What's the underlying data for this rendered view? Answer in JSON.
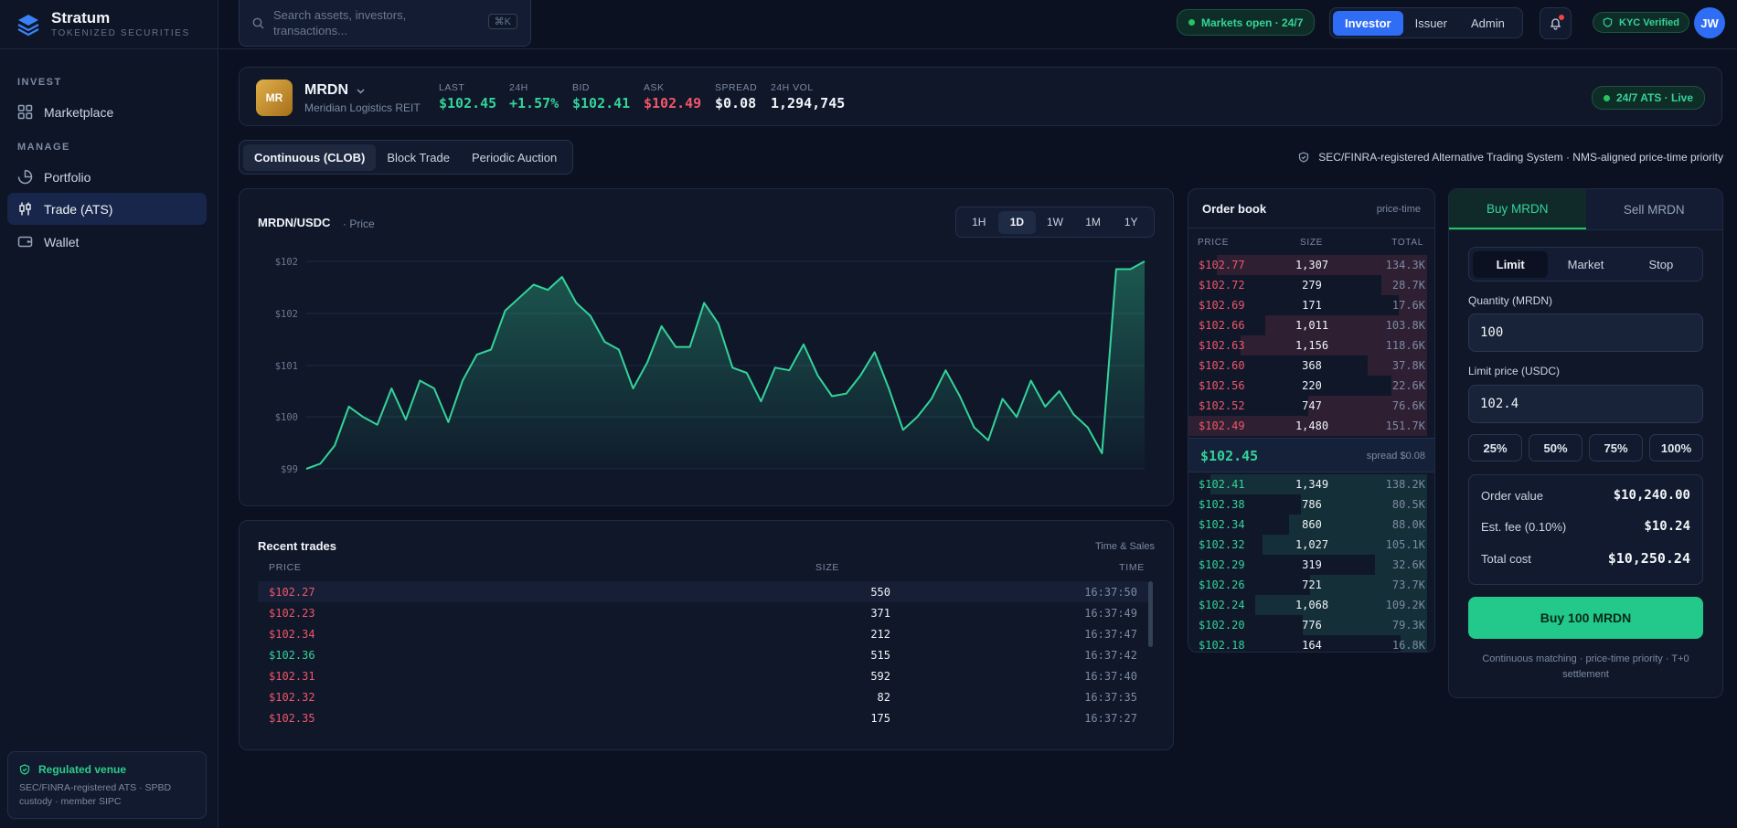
{
  "brand": {
    "name": "Stratum",
    "subtitle": "TOKENIZED SECURITIES"
  },
  "sidebar": {
    "sections": [
      {
        "label": "INVEST",
        "items": [
          {
            "label": "Marketplace",
            "icon": "grid-icon"
          }
        ]
      },
      {
        "label": "MANAGE",
        "items": [
          {
            "label": "Portfolio",
            "icon": "pie-chart-icon"
          },
          {
            "label": "Trade (ATS)",
            "icon": "candlestick-icon",
            "active": true
          },
          {
            "label": "Wallet",
            "icon": "wallet-icon"
          }
        ]
      }
    ],
    "regulated": {
      "title": "Regulated venue",
      "text": "SEC/FINRA-registered ATS · SPBD custody · member SIPC"
    }
  },
  "topbar": {
    "search_placeholder": "Search assets, investors, transactions...",
    "search_shortcut": "⌘K",
    "market_status": "Markets open · 24/7",
    "roles": [
      "Investor",
      "Issuer",
      "Admin"
    ],
    "active_role": "Investor",
    "kyc": "KYC Verified",
    "avatar_initials": "JW"
  },
  "ticker": {
    "icon_initials": "MR",
    "symbol": "MRDN",
    "name": "Meridian Logistics REIT",
    "stats": [
      {
        "label": "LAST",
        "value": "$102.45",
        "tone": "green"
      },
      {
        "label": "24H",
        "value": "+1.57%",
        "tone": "green"
      },
      {
        "label": "BID",
        "value": "$102.41",
        "tone": "green"
      },
      {
        "label": "ASK",
        "value": "$102.49",
        "tone": "red"
      },
      {
        "label": "SPREAD",
        "value": "$0.08",
        "tone": "white"
      },
      {
        "label": "24H VOL",
        "value": "1,294,745",
        "tone": "white"
      }
    ],
    "live_badge": "24/7 ATS · Live"
  },
  "modes": {
    "tabs": [
      "Continuous (CLOB)",
      "Block Trade",
      "Periodic Auction"
    ],
    "active": "Continuous (CLOB)"
  },
  "ats_note": "SEC/FINRA-registered Alternative Trading System · NMS-aligned price-time priority",
  "chart": {
    "title": "MRDN/USDC",
    "subtitle": "· Price",
    "timeframes": [
      "1H",
      "1D",
      "1W",
      "1M",
      "1Y"
    ],
    "active_timeframe": "1D",
    "line_color": "#34d399"
  },
  "chart_data": {
    "type": "area",
    "title": "MRDN/USDC",
    "yticks": [
      "$102",
      "$102",
      "$101",
      "$100",
      "$99"
    ],
    "yrange": [
      99,
      103
    ],
    "x": [
      1,
      2,
      3,
      4,
      5,
      6,
      7,
      8,
      9,
      10,
      11,
      12,
      13,
      14,
      15,
      16,
      17,
      18,
      19,
      20,
      21,
      22,
      23,
      24,
      25,
      26,
      27,
      28,
      29,
      30,
      31,
      32,
      33,
      34,
      35,
      36,
      37,
      38,
      39,
      40,
      41,
      42,
      43,
      44,
      45,
      46,
      47,
      48,
      49,
      50,
      51,
      52,
      53,
      54,
      55,
      56,
      57,
      58,
      59,
      60
    ],
    "values": [
      99.0,
      99.1,
      99.45,
      100.2,
      100.0,
      99.85,
      100.55,
      99.95,
      100.7,
      100.55,
      99.9,
      100.7,
      101.2,
      101.3,
      102.05,
      102.3,
      102.55,
      102.45,
      102.7,
      102.2,
      101.95,
      101.45,
      101.3,
      100.55,
      101.05,
      101.75,
      101.35,
      101.35,
      102.2,
      101.8,
      100.95,
      100.85,
      100.3,
      100.95,
      100.9,
      101.4,
      100.8,
      100.4,
      100.45,
      100.8,
      101.25,
      100.55,
      99.75,
      100.0,
      100.35,
      100.9,
      100.4,
      99.8,
      99.55,
      100.35,
      100.0,
      100.7,
      100.2,
      100.5,
      100.05,
      99.8,
      99.3,
      102.85,
      102.85,
      103.0
    ]
  },
  "trades": {
    "title": "Recent trades",
    "subtitle": "Time & Sales",
    "headers": [
      "PRICE",
      "SIZE",
      "TIME"
    ],
    "rows": [
      {
        "price": "$102.27",
        "size": "550",
        "time": "16:37:50",
        "tone": "red"
      },
      {
        "price": "$102.23",
        "size": "371",
        "time": "16:37:49",
        "tone": "red"
      },
      {
        "price": "$102.34",
        "size": "212",
        "time": "16:37:47",
        "tone": "red"
      },
      {
        "price": "$102.36",
        "size": "515",
        "time": "16:37:42",
        "tone": "green"
      },
      {
        "price": "$102.31",
        "size": "592",
        "time": "16:37:40",
        "tone": "red"
      },
      {
        "price": "$102.32",
        "size": "82",
        "time": "16:37:35",
        "tone": "red"
      },
      {
        "price": "$102.35",
        "size": "175",
        "time": "16:37:27",
        "tone": "red"
      }
    ]
  },
  "orderbook": {
    "title": "Order book",
    "subtitle": "price-time",
    "headers": [
      "PRICE",
      "SIZE",
      "TOTAL"
    ],
    "asks": [
      {
        "price": "$102.77",
        "size": "1,307",
        "total": "134.3K",
        "depth": 0.88
      },
      {
        "price": "$102.72",
        "size": "279",
        "total": "28.7K",
        "depth": 0.19
      },
      {
        "price": "$102.69",
        "size": "171",
        "total": "17.6K",
        "depth": 0.12
      },
      {
        "price": "$102.66",
        "size": "1,011",
        "total": "103.8K",
        "depth": 0.68
      },
      {
        "price": "$102.63",
        "size": "1,156",
        "total": "118.6K",
        "depth": 0.78
      },
      {
        "price": "$102.60",
        "size": "368",
        "total": "37.8K",
        "depth": 0.25
      },
      {
        "price": "$102.56",
        "size": "220",
        "total": "22.6K",
        "depth": 0.15
      },
      {
        "price": "$102.52",
        "size": "747",
        "total": "76.6K",
        "depth": 0.5
      },
      {
        "price": "$102.49",
        "size": "1,480",
        "total": "151.7K",
        "depth": 1.0
      }
    ],
    "mid_price": "$102.45",
    "spread": "spread $0.08",
    "bids": [
      {
        "price": "$102.41",
        "size": "1,349",
        "total": "138.2K",
        "depth": 0.91
      },
      {
        "price": "$102.38",
        "size": "786",
        "total": "80.5K",
        "depth": 0.53
      },
      {
        "price": "$102.34",
        "size": "860",
        "total": "88.0K",
        "depth": 0.58
      },
      {
        "price": "$102.32",
        "size": "1,027",
        "total": "105.1K",
        "depth": 0.69
      },
      {
        "price": "$102.29",
        "size": "319",
        "total": "32.6K",
        "depth": 0.22
      },
      {
        "price": "$102.26",
        "size": "721",
        "total": "73.7K",
        "depth": 0.49
      },
      {
        "price": "$102.24",
        "size": "1,068",
        "total": "109.2K",
        "depth": 0.72
      },
      {
        "price": "$102.20",
        "size": "776",
        "total": "79.3K",
        "depth": 0.52
      },
      {
        "price": "$102.18",
        "size": "164",
        "total": "16.8K",
        "depth": 0.11
      }
    ]
  },
  "ticket": {
    "buy_label": "Buy MRDN",
    "sell_label": "Sell MRDN",
    "order_types": [
      "Limit",
      "Market",
      "Stop"
    ],
    "active_type": "Limit",
    "quantity_label": "Quantity (MRDN)",
    "quantity_value": "100",
    "limit_label": "Limit price (USDC)",
    "limit_value": "102.4",
    "percentages": [
      "25%",
      "50%",
      "75%",
      "100%"
    ],
    "order_value_label": "Order value",
    "order_value": "$10,240.00",
    "fee_label": "Est. fee (0.10%)",
    "fee": "$10.24",
    "total_label": "Total cost",
    "total": "$10,250.24",
    "submit_label": "Buy 100 MRDN",
    "note": "Continuous matching · price-time priority · T+0 settlement"
  }
}
